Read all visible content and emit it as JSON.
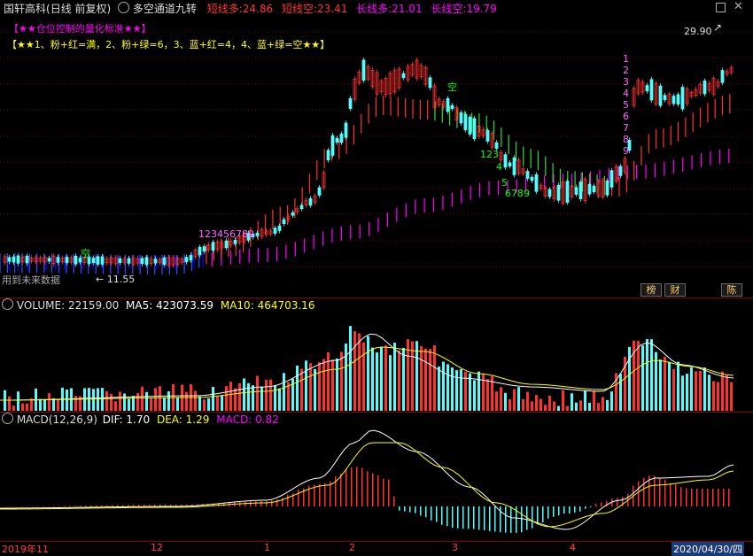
{
  "header": {
    "stock": "国轩高科",
    "period": "(日线 前复权)",
    "indicator": "多空通道九转",
    "short_long_label": "短线多:",
    "short_long_value": "24.86",
    "short_short_label": "短线空:",
    "short_short_value": "23.41",
    "long_long_label": "长线多:",
    "long_long_value": "21.01",
    "long_short_label": "长线空:",
    "long_short_value": "19.79"
  },
  "notes": {
    "line1": "【★★仓位控制的量化标准★★】",
    "line2": "【★★1、粉+红=满，2、粉+绿=6，3、蓝+红=4，4、蓝+绿=空★★】"
  },
  "price_panel": {
    "high_label": "29.90",
    "low_label": "← 11.55",
    "future_data_note": "用到未来数据",
    "empty_signal_1": "空",
    "empty_signal_2": "空",
    "count_up_1": "123456789",
    "count_down_1": "123",
    "count_down_2": "4",
    "count_down_3": "5",
    "count_down_4": "6789",
    "count_up_2": "123456789",
    "bottom_buttons": [
      "榜",
      "财",
      "陈"
    ]
  },
  "volume_panel": {
    "label": "VOLUME:",
    "value": "22159.00",
    "ma5_label": "MA5:",
    "ma5_value": "423073.59",
    "ma10_label": "MA10:",
    "ma10_value": "464703.16"
  },
  "macd_panel": {
    "label": "MACD(12,26,9)",
    "dif_label": "DIF:",
    "dif_value": "1.70",
    "dea_label": "DEA:",
    "dea_value": "1.29",
    "macd_label": "MACD:",
    "macd_value": "0.82"
  },
  "time_axis": {
    "labels": [
      "2019年11",
      "12",
      "1",
      "2",
      "3",
      "4"
    ],
    "current_date": "2020/04/30/四"
  },
  "colors": {
    "background": "#000000",
    "up": "#ff3232",
    "down": "#54fcfc",
    "ma5": "#ffffff",
    "ma10": "#ffff00",
    "magenta": "#ff00ff",
    "green": "#00ff00",
    "blue": "#0000ff",
    "separator": "#8b0000"
  },
  "icons": {
    "window_restore": "restore-icon",
    "window_close": "close-icon"
  }
}
